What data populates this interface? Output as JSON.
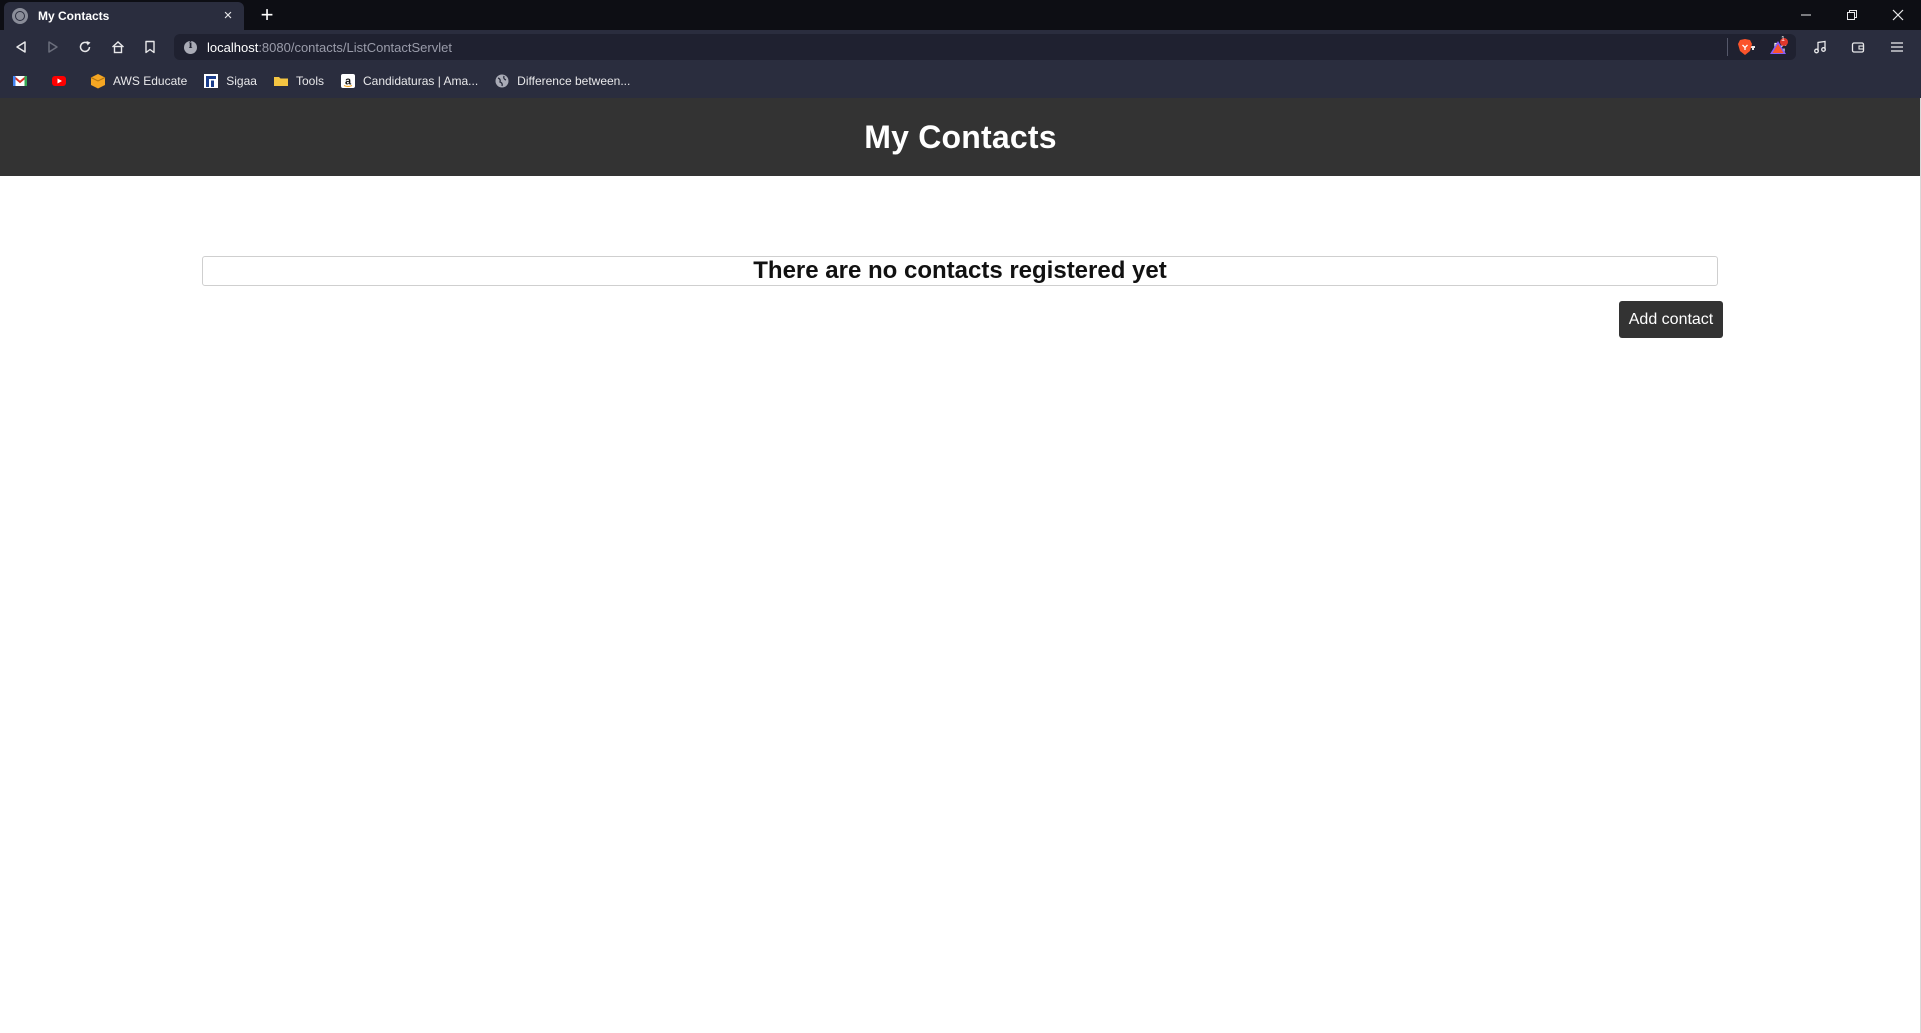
{
  "browser": {
    "tab": {
      "title": "My Contacts",
      "close": "×"
    },
    "new_tab": "+",
    "url": {
      "host": "localhost",
      "rest": ":8080/contacts/ListContactServlet"
    },
    "badge_count": "1",
    "window_controls": [
      "minimize-icon",
      "restore-icon",
      "close-icon"
    ],
    "bookmarks": [
      {
        "label": "",
        "icon": "gmail-icon",
        "color": "#d93025"
      },
      {
        "label": "",
        "icon": "youtube-icon",
        "color": "#ff0000"
      },
      {
        "label": "AWS Educate",
        "icon": "aws-box-icon",
        "color": "#f5a623"
      },
      {
        "label": "Sigaa",
        "icon": "sigaa-icon",
        "color": "#ffffff"
      },
      {
        "label": "Tools",
        "icon": "folder-icon",
        "color": "#f4c542"
      },
      {
        "label": "Candidaturas | Ama...",
        "icon": "amazon-icon",
        "color": "#ffffff"
      },
      {
        "label": "Difference between...",
        "icon": "globe-icon",
        "color": "#a9abb6"
      }
    ]
  },
  "page": {
    "header_title": "My Contacts",
    "empty_message": "There are no contacts registered yet",
    "add_button_label": "Add contact"
  },
  "colors": {
    "header_bg": "#333333",
    "button_bg": "#333333",
    "chrome_bg": "#2a2d3e",
    "tabstrip_bg": "#0d0e14",
    "brave_orange": "#fb542b"
  }
}
